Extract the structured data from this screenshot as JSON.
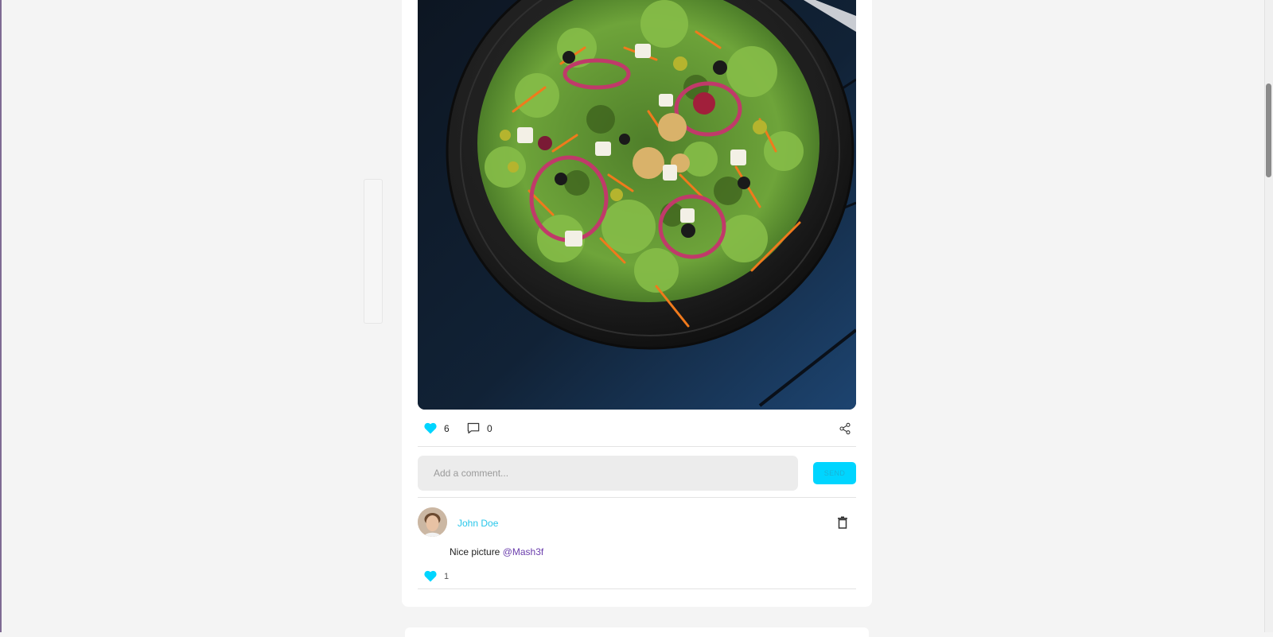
{
  "post": {
    "image_alt": "Salad with lettuce, carrots, olives, walnuts, red onion and feta on a dark plate",
    "likes": "6",
    "comments_count": "0"
  },
  "comment_form": {
    "placeholder": "Add a comment...",
    "send_label": "SEND"
  },
  "comments": [
    {
      "author": "John Doe",
      "text": "Nice picture ",
      "mention": "@Mash3f",
      "likes": "1"
    }
  ],
  "colors": {
    "accent": "#00d5ff",
    "mention": "#6a3dac",
    "author_link": "#27c6ea"
  },
  "icons": [
    "heart-icon",
    "comment-icon",
    "share-icon",
    "trash-icon"
  ]
}
